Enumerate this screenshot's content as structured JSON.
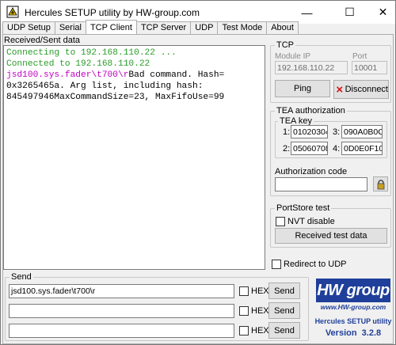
{
  "window": {
    "title": "Hercules SETUP utility by HW-group.com",
    "minimize": "—",
    "maximize": "☐",
    "close": "✕"
  },
  "tabs": [
    {
      "label": "UDP Setup",
      "active": false
    },
    {
      "label": "Serial",
      "active": false
    },
    {
      "label": "TCP Client",
      "active": true
    },
    {
      "label": "TCP Server",
      "active": false
    },
    {
      "label": "UDP",
      "active": false
    },
    {
      "label": "Test Mode",
      "active": false
    },
    {
      "label": "About",
      "active": false
    }
  ],
  "received": {
    "label": "Received/Sent data",
    "line1": "Connecting to 192.168.110.22 ...",
    "line2": "Connected to 192.168.110.22",
    "line3_cmd": "jsd100.sys.fader\\t700\\r",
    "line3_rest": "Bad command. Hash=",
    "line4": "0x3265465a. Arg list, including hash:",
    "line5": "845497946MaxCommandSize=23, MaxFifoUse=99"
  },
  "tcp": {
    "group_label": "TCP",
    "module_ip_label": "Module IP",
    "module_ip": "192.168.110.22",
    "port_label": "Port",
    "port": "10001",
    "ping_label": "Ping",
    "disconnect_label": "Disconnect"
  },
  "tea": {
    "group_label": "TEA authorization",
    "key_label": "TEA key",
    "keys": [
      {
        "n": "1:",
        "value": "01020304"
      },
      {
        "n": "3:",
        "value": "090A0B0C"
      },
      {
        "n": "2:",
        "value": "05060708"
      },
      {
        "n": "4:",
        "value": "0D0E0F10"
      }
    ],
    "auth_code_label": "Authorization code",
    "auth_code": ""
  },
  "portstore": {
    "group_label": "PortStore test",
    "nvt_label": "NVT disable",
    "received_btn": "Received test data"
  },
  "redirect_label": "Redirect to UDP",
  "send": {
    "group_label": "Send",
    "rows": [
      {
        "value": "jsd100.sys.fader\\t700\\r",
        "hex_label": "HEX",
        "button": "Send"
      },
      {
        "value": "",
        "hex_label": "HEX",
        "button": "Send"
      },
      {
        "value": "",
        "hex_label": "HEX",
        "button": "Send"
      }
    ]
  },
  "logo": {
    "brand": "HW group",
    "site": "www.HW-group.com",
    "product": "Hercules SETUP utility",
    "version": "Version  3.2.8"
  },
  "colors": {
    "connected_text": "#2a9d2a",
    "command_text": "#c000c0",
    "logo_blue": "#1f3f9a"
  }
}
